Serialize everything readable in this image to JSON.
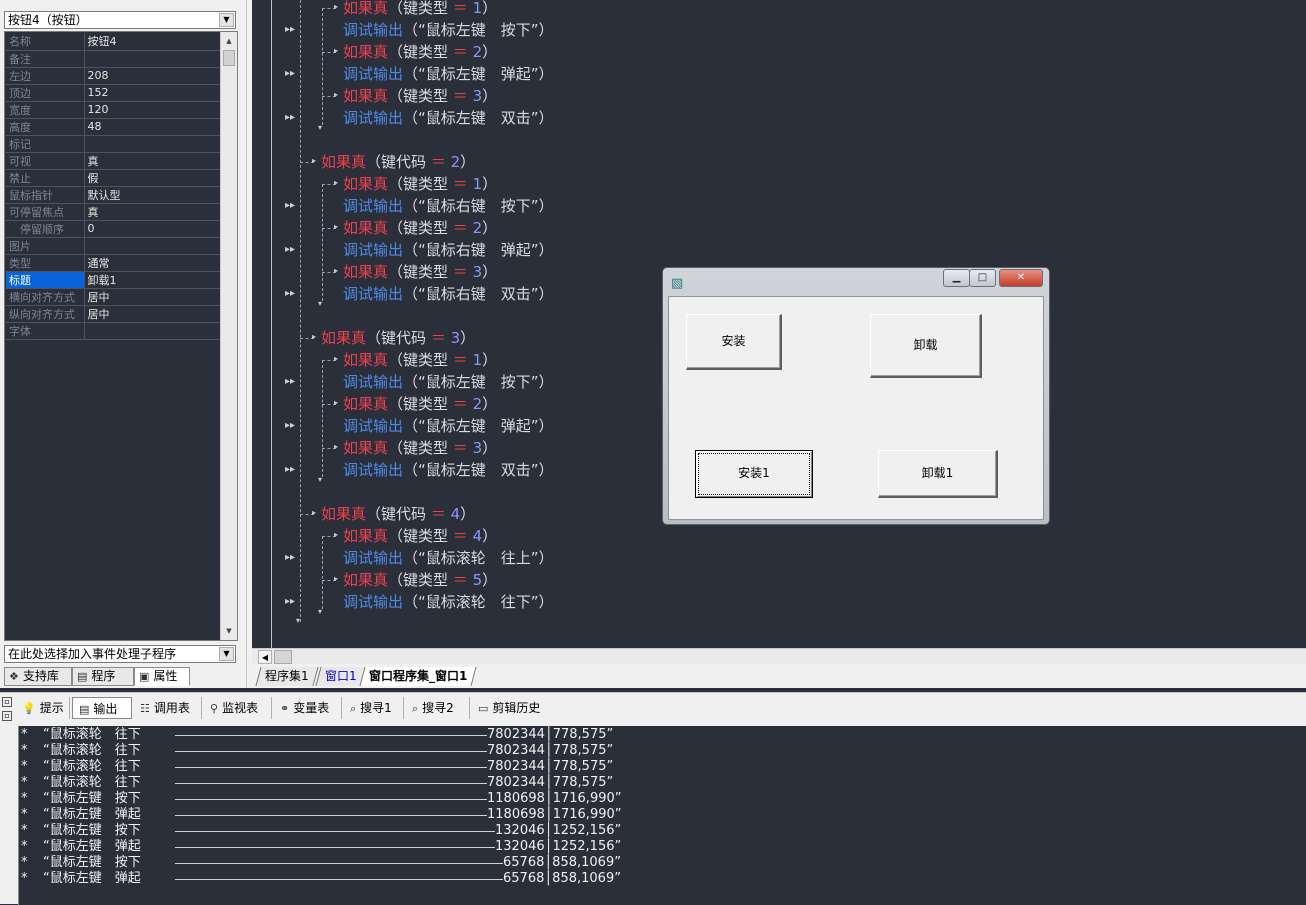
{
  "left": {
    "object_select": "按钮4（按钮）",
    "properties": [
      {
        "name": "名称",
        "value": "按钮4"
      },
      {
        "name": "备注",
        "value": ""
      },
      {
        "name": "左边",
        "value": "208"
      },
      {
        "name": "顶边",
        "value": "152"
      },
      {
        "name": "宽度",
        "value": "120"
      },
      {
        "name": "高度",
        "value": "48"
      },
      {
        "name": "标记",
        "value": ""
      },
      {
        "name": "可视",
        "value": "真"
      },
      {
        "name": "禁止",
        "value": "假"
      },
      {
        "name": "鼠标指针",
        "value": "默认型"
      },
      {
        "name": "可停留焦点",
        "value": "真"
      },
      {
        "name": "停留顺序",
        "value": "0"
      },
      {
        "name": "图片",
        "value": ""
      },
      {
        "name": "类型",
        "value": "通常"
      },
      {
        "name": "标题",
        "value": "卸载1"
      },
      {
        "name": "横向对齐方式",
        "value": "居中"
      },
      {
        "name": "纵向对齐方式",
        "value": "居中"
      },
      {
        "name": "字体",
        "value": ""
      }
    ],
    "event_select": "在此处选择加入事件处理子程序",
    "tabs": [
      "支持库",
      "程序",
      "属性"
    ]
  },
  "code": {
    "lines": [
      {
        "kw": "如果真",
        "arg": "（键类型 ",
        "op": "＝",
        "num": " 1",
        "close": "）",
        "level": 2,
        "kind": "if"
      },
      {
        "fn": "调试输出",
        "str": "（“鼠标左键　按下”）",
        "level": 2,
        "kind": "call"
      },
      {
        "kw": "如果真",
        "arg": "（键类型 ",
        "op": "＝",
        "num": " 2",
        "close": "）",
        "level": 2,
        "kind": "if"
      },
      {
        "fn": "调试输出",
        "str": "（“鼠标左键　弹起”）",
        "level": 2,
        "kind": "call"
      },
      {
        "kw": "如果真",
        "arg": "（键类型 ",
        "op": "＝",
        "num": " 3",
        "close": "）",
        "level": 2,
        "kind": "if"
      },
      {
        "fn": "调试输出",
        "str": "（“鼠标左键　双击”）",
        "level": 2,
        "kind": "call"
      },
      {
        "kw": "如果真",
        "arg": "（键代码 ",
        "op": "＝",
        "num": " 2",
        "close": "）",
        "level": 1,
        "kind": "if"
      },
      {
        "kw": "如果真",
        "arg": "（键类型 ",
        "op": "＝",
        "num": " 1",
        "close": "）",
        "level": 2,
        "kind": "if"
      },
      {
        "fn": "调试输出",
        "str": "（“鼠标右键　按下”）",
        "level": 2,
        "kind": "call"
      },
      {
        "kw": "如果真",
        "arg": "（键类型 ",
        "op": "＝",
        "num": " 2",
        "close": "）",
        "level": 2,
        "kind": "if"
      },
      {
        "fn": "调试输出",
        "str": "（“鼠标右键　弹起”）",
        "level": 2,
        "kind": "call"
      },
      {
        "kw": "如果真",
        "arg": "（键类型 ",
        "op": "＝",
        "num": " 3",
        "close": "）",
        "level": 2,
        "kind": "if"
      },
      {
        "fn": "调试输出",
        "str": "（“鼠标右键　双击”）",
        "level": 2,
        "kind": "call"
      },
      {
        "kw": "如果真",
        "arg": "（键代码 ",
        "op": "＝",
        "num": " 3",
        "close": "）",
        "level": 1,
        "kind": "if"
      },
      {
        "kw": "如果真",
        "arg": "（键类型 ",
        "op": "＝",
        "num": " 1",
        "close": "）",
        "level": 2,
        "kind": "if"
      },
      {
        "fn": "调试输出",
        "str": "（“鼠标左键　按下”）",
        "level": 2,
        "kind": "call"
      },
      {
        "kw": "如果真",
        "arg": "（键类型 ",
        "op": "＝",
        "num": " 2",
        "close": "）",
        "level": 2,
        "kind": "if"
      },
      {
        "fn": "调试输出",
        "str": "（“鼠标左键　弹起”）",
        "level": 2,
        "kind": "call"
      },
      {
        "kw": "如果真",
        "arg": "（键类型 ",
        "op": "＝",
        "num": " 3",
        "close": "）",
        "level": 2,
        "kind": "if"
      },
      {
        "fn": "调试输出",
        "str": "（“鼠标左键　双击”）",
        "level": 2,
        "kind": "call"
      },
      {
        "kw": "如果真",
        "arg": "（键代码 ",
        "op": "＝",
        "num": " 4",
        "close": "）",
        "level": 1,
        "kind": "if"
      },
      {
        "kw": "如果真",
        "arg": "（键类型 ",
        "op": "＝",
        "num": " 4",
        "close": "）",
        "level": 2,
        "kind": "if"
      },
      {
        "fn": "调试输出",
        "str": "（“鼠标滚轮　往上”）",
        "level": 2,
        "kind": "call"
      },
      {
        "kw": "如果真",
        "arg": "（键类型 ",
        "op": "＝",
        "num": " 5",
        "close": "）",
        "level": 2,
        "kind": "if"
      },
      {
        "fn": "调试输出",
        "str": "（“鼠标滚轮　往下”）",
        "level": 2,
        "kind": "call"
      }
    ]
  },
  "doc_tabs": [
    "程序集1",
    "窗口1",
    "窗口程序集_窗口1"
  ],
  "bottom": {
    "tabs": [
      "提示",
      "输出",
      "调用表",
      "监视表",
      "变量表",
      "搜寻1",
      "搜寻2",
      "剪辑历史"
    ],
    "output": [
      {
        "msg": "“鼠标滚轮　往下",
        "vals": "7802344│778,575”"
      },
      {
        "msg": "“鼠标滚轮　往下",
        "vals": "7802344│778,575”"
      },
      {
        "msg": "“鼠标滚轮　往下",
        "vals": "7802344│778,575”"
      },
      {
        "msg": "“鼠标滚轮　往下",
        "vals": "7802344│778,575”"
      },
      {
        "msg": "“鼠标左键　按下",
        "vals": "1180698│1716,990”"
      },
      {
        "msg": "“鼠标左键　弹起",
        "vals": "1180698│1716,990”"
      },
      {
        "msg": "“鼠标左键　按下",
        "vals": "132046│1252,156”"
      },
      {
        "msg": "“鼠标左键　弹起",
        "vals": "132046│1252,156”"
      },
      {
        "msg": "“鼠标左键　按下",
        "vals": "65768│858,1069”"
      },
      {
        "msg": "“鼠标左键　弹起",
        "vals": "65768│858,1069”"
      }
    ]
  },
  "dialog": {
    "buttons": [
      "安装",
      "卸载",
      "安装1",
      "卸载1"
    ]
  }
}
